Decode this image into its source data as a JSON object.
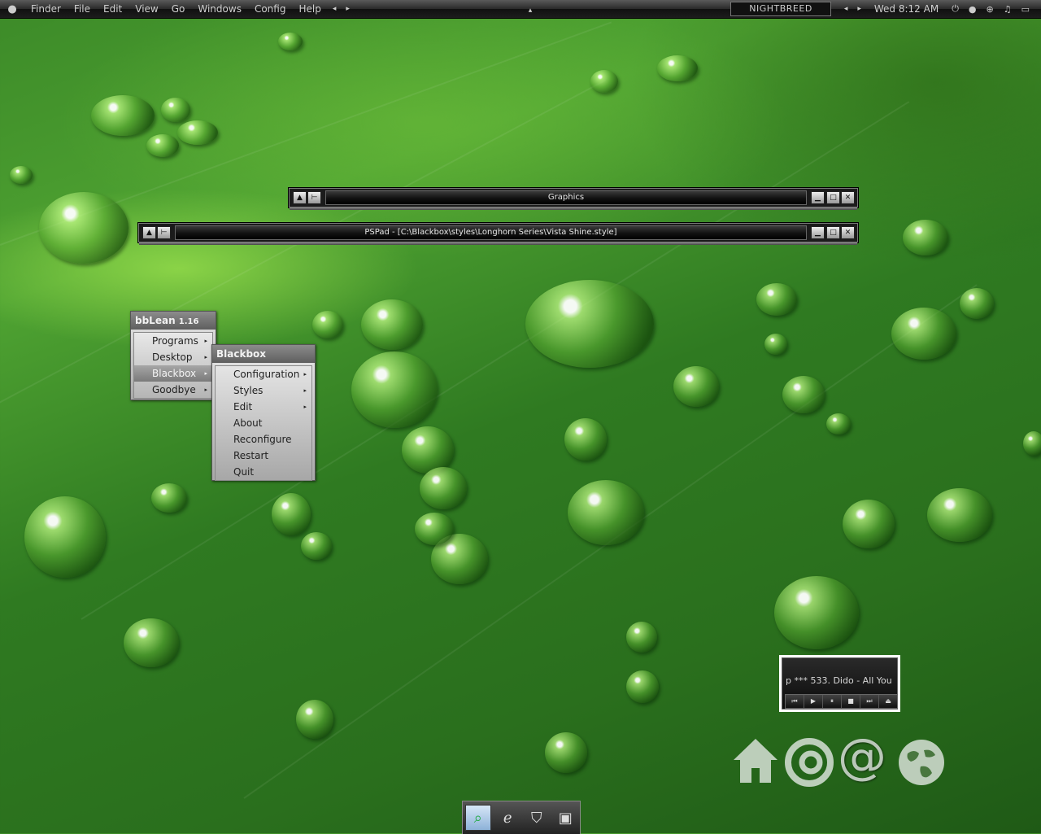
{
  "menubar": {
    "apple_icon": "apple-icon",
    "items": [
      "Finder",
      "File",
      "Edit",
      "View",
      "Go",
      "Windows",
      "Config",
      "Help"
    ],
    "nav_back": "◂",
    "nav_fwd": "▸",
    "collapse": "▴",
    "workspace": "NIGHTBREED",
    "ws_prev": "◂",
    "ws_next": "▸",
    "clock": "Wed 8:12 AM",
    "tray": [
      "⏻",
      "●",
      "⊕",
      "♫",
      "▭"
    ]
  },
  "windows": [
    {
      "title": "Graphics"
    },
    {
      "title": "PSPad - [C:\\Blackbox\\styles\\Longhorn Series\\Vista Shine.style]"
    }
  ],
  "window_buttons": {
    "up": "▲",
    "pin": "⊢",
    "min": "▁",
    "max": "□",
    "close": "✕"
  },
  "main_menu": {
    "title": "bbLean",
    "version": "1.16",
    "items": [
      {
        "label": "Programs",
        "submenu": true
      },
      {
        "label": "Desktop",
        "submenu": true
      },
      {
        "label": "Blackbox",
        "submenu": true,
        "active": true
      },
      {
        "label": "Goodbye",
        "submenu": true
      }
    ]
  },
  "blackbox_menu": {
    "title": "Blackbox",
    "items": [
      {
        "label": "Configuration",
        "submenu": true
      },
      {
        "label": "Styles",
        "submenu": true
      },
      {
        "label": "Edit",
        "submenu": true
      },
      {
        "label": "About"
      },
      {
        "label": "Reconfigure"
      },
      {
        "label": "Restart"
      },
      {
        "label": "Quit"
      }
    ]
  },
  "media_player": {
    "track": "p *** 533. Dido - All You",
    "controls": [
      "⏮",
      "▶",
      "⏸",
      "■",
      "⏭",
      "⏏"
    ]
  },
  "desktop_icons": [
    "home-icon",
    "copyright-like-icon",
    "at-icon",
    "globe-icon"
  ],
  "dock": [
    "explorer-search-icon",
    "internet-explorer-icon",
    "shield-icon",
    "window-manager-icon"
  ]
}
